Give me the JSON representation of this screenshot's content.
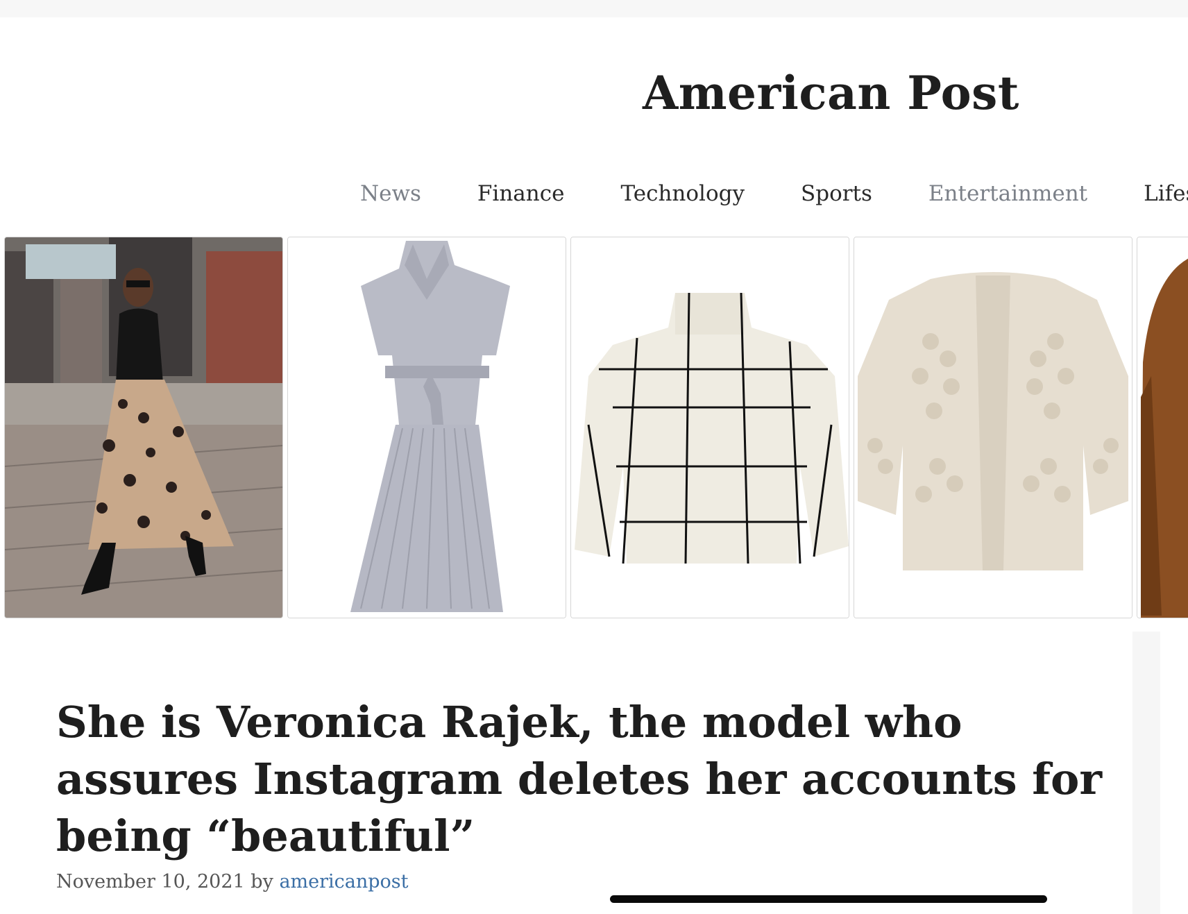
{
  "site": {
    "title": "American Post"
  },
  "nav": [
    {
      "label": "News",
      "muted": true
    },
    {
      "label": "Finance",
      "muted": false
    },
    {
      "label": "Technology",
      "muted": false
    },
    {
      "label": "Sports",
      "muted": false
    },
    {
      "label": "Entertainment",
      "muted": true
    },
    {
      "label": "Lifestyle",
      "muted": false
    }
  ],
  "carousel": [
    {
      "image": "model-in-floral-tulle-skirt-photo"
    },
    {
      "image": "grey-wrap-pleated-dress-photo"
    },
    {
      "image": "white-grid-turtleneck-sweater-photo"
    },
    {
      "image": "cream-pom-pom-cardigan-photo"
    },
    {
      "image": "brown-sweater-photo"
    }
  ],
  "article": {
    "title": "She is Veronica Rajek, the model who assures Instagram deletes her accounts for being “beautiful”",
    "date": "November 10, 2021",
    "by": "by",
    "author": "americanpost"
  },
  "colors": {
    "text": "#1e1e1e",
    "nav_muted": "#7b8088",
    "link": "#3a6ea5",
    "background": "#f6f6f6",
    "card": "#ffffff"
  }
}
